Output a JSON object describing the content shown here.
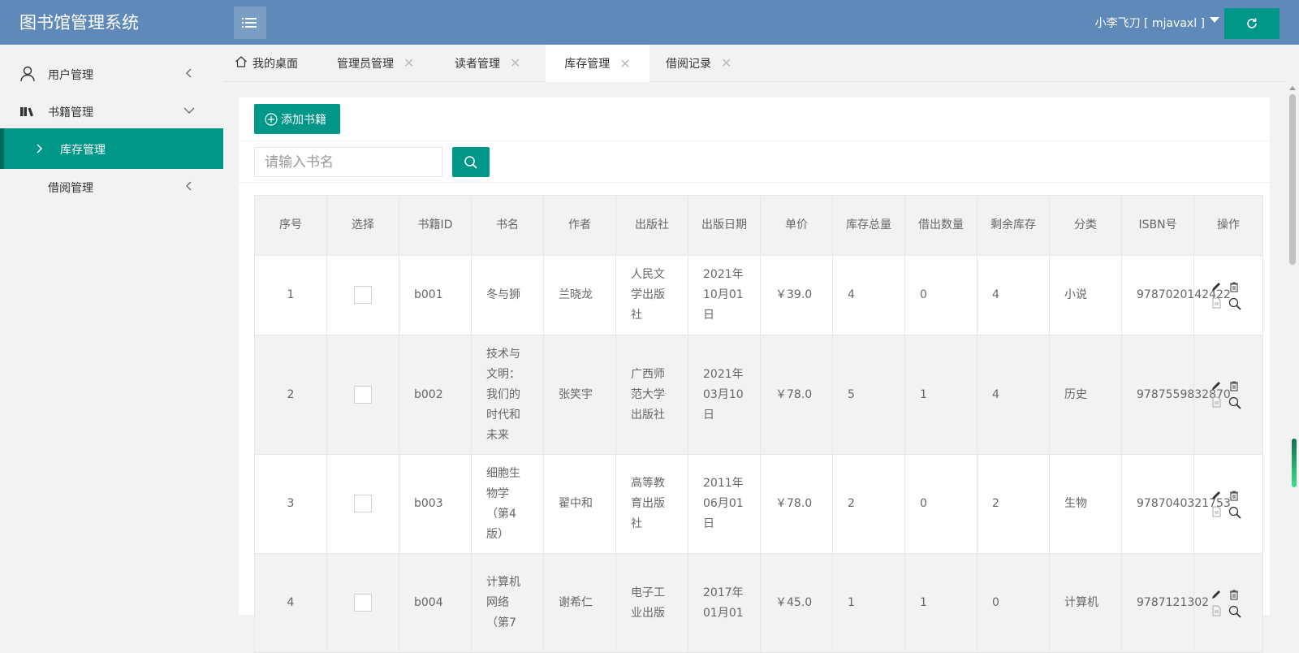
{
  "header": {
    "title": "图书馆管理系统",
    "user": "小李飞刀 [ mjavaxl ]"
  },
  "sidebar": {
    "items": [
      {
        "label": "用户管理",
        "icon": "user-icon",
        "arrow": "chevron-left-icon"
      },
      {
        "label": "书籍管理",
        "icon": "books-icon",
        "arrow": "chevron-down-icon"
      },
      {
        "label": "库存管理",
        "icon": "chevron-right-icon",
        "active": true
      },
      {
        "label": "借阅管理",
        "arrow": "chevron-left-icon"
      }
    ]
  },
  "tabs": [
    {
      "label": "我的桌面",
      "icon": "home-icon"
    },
    {
      "label": "管理员管理"
    },
    {
      "label": "读者管理"
    },
    {
      "label": "库存管理",
      "active": true
    },
    {
      "label": "借阅记录"
    }
  ],
  "toolbar": {
    "add_label": "添加书籍",
    "search_placeholder": "请输入书名"
  },
  "table": {
    "headers": [
      "序号",
      "选择",
      "书籍ID",
      "书名",
      "作者",
      "出版社",
      "出版日期",
      "单价",
      "库存总量",
      "借出数量",
      "剩余库存",
      "分类",
      "ISBN号",
      "操作"
    ],
    "rows": [
      {
        "no": "1",
        "id": "b001",
        "name": "冬与狮",
        "author": "兰晓龙",
        "publisher": "人民文学出版社",
        "date": "2021年10月01日",
        "price": "￥39.0",
        "total": "4",
        "lent": "0",
        "left": "4",
        "category": "小说",
        "isbn": "9787020142422"
      },
      {
        "no": "2",
        "id": "b002",
        "name": "技术与文明：我们的时代和未来",
        "author": "张笑宇",
        "publisher": "广西师范大学出版社",
        "date": "2021年03月10日",
        "price": "￥78.0",
        "total": "5",
        "lent": "1",
        "left": "4",
        "category": "历史",
        "isbn": "9787559832870"
      },
      {
        "no": "3",
        "id": "b003",
        "name": "细胞生物学（第4版）",
        "author": "翟中和",
        "publisher": "高等教育出版社",
        "date": "2011年06月01日",
        "price": "￥78.0",
        "total": "2",
        "lent": "0",
        "left": "2",
        "category": "生物",
        "isbn": "9787040321753"
      },
      {
        "no": "4",
        "id": "b004",
        "name": "计算机网络（第7",
        "author": "谢希仁",
        "publisher": "电子工业出版",
        "date": "2017年01月01",
        "price": "￥45.0",
        "total": "1",
        "lent": "1",
        "left": "0",
        "category": "计算机",
        "isbn": "9787121302"
      }
    ]
  },
  "colors": {
    "header": "#5f89b9",
    "accent": "#009688"
  }
}
